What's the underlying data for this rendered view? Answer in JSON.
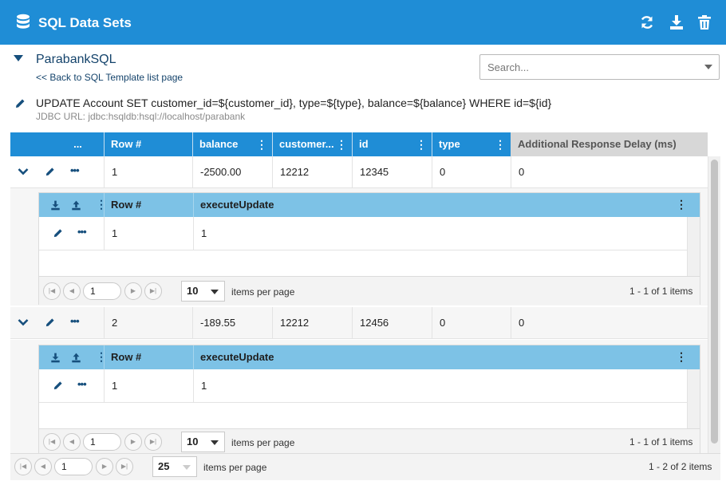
{
  "header": {
    "title": "SQL Data Sets",
    "icons": [
      "database-icon",
      "refresh-icon",
      "download-icon",
      "trash-icon"
    ]
  },
  "dataset": {
    "name": "ParabankSQL",
    "back_link": "<< Back to SQL Template list page",
    "search_placeholder": "Search...",
    "sql": "UPDATE Account SET customer_id=${customer_id}, type=${type}, balance=${balance} WHERE id=${id}",
    "jdbc": "JDBC URL: jdbc:hsqldb:hsql://localhost/parabank"
  },
  "grid": {
    "actions_header": "...",
    "columns": [
      "Row #",
      "balance",
      "customer...",
      "id",
      "type",
      "Additional Response Delay (ms)"
    ],
    "rows": [
      {
        "row": "1",
        "balance": "-2500.00",
        "customer": "12212",
        "id": "12345",
        "type": "0",
        "delay": "0"
      },
      {
        "row": "2",
        "balance": "-189.55",
        "customer": "12212",
        "id": "12456",
        "type": "0",
        "delay": "0"
      }
    ]
  },
  "subgrid": {
    "columns": [
      "Row #",
      "executeUpdate"
    ],
    "rows": [
      {
        "row": "1",
        "execute": "1"
      },
      {
        "row": "1",
        "execute": "1"
      }
    ],
    "page": "1",
    "page_size": "10",
    "items_per_page": "items per page",
    "summary": "1 - 1 of 1 items"
  },
  "pager": {
    "page": "1",
    "page_size": "25",
    "items_per_page": "items per page",
    "summary": "1 - 2 of 2 items"
  },
  "colors": {
    "header": "#1f8dd6",
    "subheader": "#7dc2e6",
    "dark_icon": "#164f7d"
  }
}
